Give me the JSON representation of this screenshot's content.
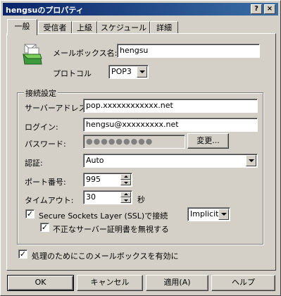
{
  "window": {
    "title": "hengsuのプロパティ",
    "help_glyph": "?",
    "close_glyph": "×"
  },
  "tabs": [
    {
      "label": "一般"
    },
    {
      "label": "受信者"
    },
    {
      "label": "上級"
    },
    {
      "label": "スケジュール"
    },
    {
      "label": "詳細"
    }
  ],
  "general": {
    "mailbox_name_label": "メールボックス名:",
    "mailbox_name_value": "hengsu",
    "protocol_label": "プロトコル",
    "protocol_value": "POP3"
  },
  "connection": {
    "group_label": "接続設定",
    "server_label": "サーバーアドレス:",
    "server_value": "pop.xxxxxxxxxxxx.net",
    "login_label": "ログイン:",
    "login_value": "hengsu@xxxxxxxxx.net",
    "password_label": "パスワード:",
    "password_mask": "●●●●●●●●●",
    "change_button": "変更...",
    "auth_label": "認証:",
    "auth_value": "Auto",
    "port_label": "ポート番号:",
    "port_value": "995",
    "timeout_label": "タイムアウト:",
    "timeout_value": "30",
    "timeout_unit": "秒",
    "ssl_label": "Secure Sockets Layer (SSL)で接続",
    "ssl_checked": true,
    "ssl_mode_value": "Implicit",
    "ignore_cert_label": "不正なサーバー証明書を無視する",
    "ignore_cert_checked": true
  },
  "enable_mailbox_label": "処理のためにこのメールボックスを有効に",
  "enable_mailbox_checked": true,
  "checkmark": "✓",
  "buttons": {
    "ok": "OK",
    "cancel": "キャンセル",
    "apply": "適用(A)",
    "help": "ヘルプ"
  },
  "colors": {
    "face": "#d4d0c8",
    "title_start": "#0a246a",
    "title_end": "#3a6ea5"
  }
}
